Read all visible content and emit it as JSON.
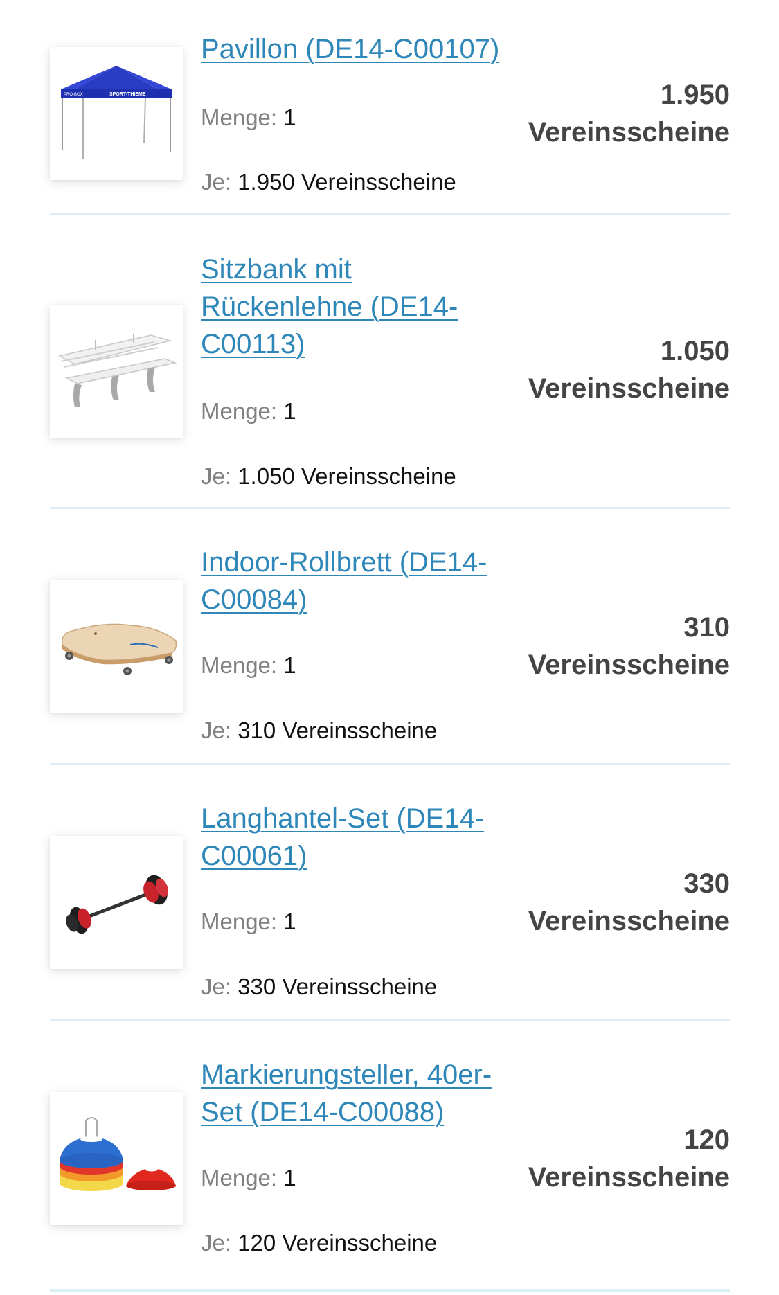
{
  "cart": {
    "qty_label": "Menge:",
    "each_label": "Je:",
    "currency_unit": "Vereinsscheine",
    "items": [
      {
        "title": "Pavillon (DE14-C00107)",
        "quantity": "1",
        "unit_price": "1.950",
        "total": "1.950",
        "image_icon": "pavilion-icon"
      },
      {
        "title": "Sitzbank mit Rückenlehne (DE14-C00113)",
        "quantity": "1",
        "unit_price": "1.050",
        "total": "1.050",
        "image_icon": "bench-icon"
      },
      {
        "title": "Indoor-Rollbrett (DE14-C00084)",
        "quantity": "1",
        "unit_price": "310",
        "total": "310",
        "image_icon": "scooter-board-icon"
      },
      {
        "title": "Langhantel-Set (DE14-C00061)",
        "quantity": "1",
        "unit_price": "330",
        "total": "330",
        "image_icon": "barbell-icon"
      },
      {
        "title": "Markierungsteller, 40er-Set (DE14-C00088)",
        "quantity": "1",
        "unit_price": "120",
        "total": "120",
        "image_icon": "marker-cones-icon"
      }
    ]
  },
  "colors": {
    "link": "#2e87b8",
    "divider": "#d9eef6",
    "price": "#444444",
    "label": "#808080"
  }
}
